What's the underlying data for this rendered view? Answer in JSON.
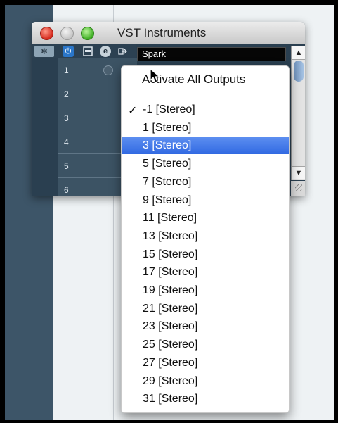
{
  "window": {
    "title": "VST Instruments",
    "instrument_name": "Spark"
  },
  "toolbar": {
    "edit_glyph": "e"
  },
  "slots": [
    "1",
    "2",
    "3",
    "4",
    "5",
    "6"
  ],
  "menu": {
    "header": "Activate All Outputs",
    "check_mark": "✓",
    "selected_index": 2,
    "items": [
      "-1 [Stereo]",
      "1 [Stereo]",
      "3 [Stereo]",
      "5 [Stereo]",
      "7 [Stereo]",
      "9 [Stereo]",
      "11 [Stereo]",
      "13 [Stereo]",
      "15 [Stereo]",
      "17 [Stereo]",
      "19 [Stereo]",
      "21 [Stereo]",
      "23 [Stereo]",
      "25 [Stereo]",
      "27 [Stereo]",
      "29 [Stereo]",
      "31 [Stereo]"
    ]
  },
  "colors": {
    "highlight": "#3d74e6",
    "panel": "#2a3f50",
    "slot_background": "#3c5364"
  }
}
